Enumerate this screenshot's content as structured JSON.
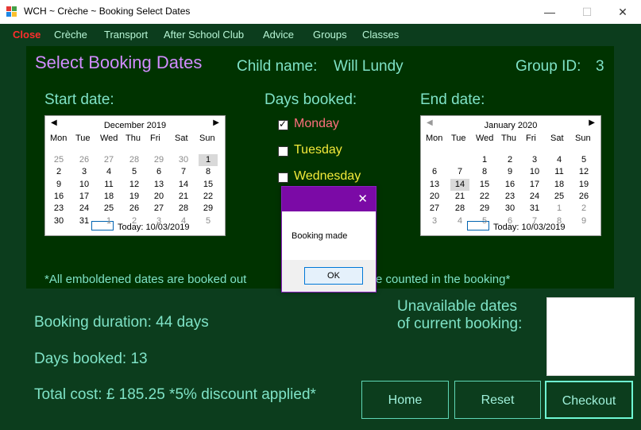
{
  "window": {
    "title": "WCH ~ Crèche ~ Booking Select Dates",
    "minimize": "—",
    "maximize": "☐",
    "close": "✕"
  },
  "menu": {
    "close": "Close",
    "items": [
      "Crèche",
      "Transport",
      "After School Club",
      "Advice",
      "Groups",
      "Classes"
    ]
  },
  "header": {
    "title": "Select Booking Dates",
    "child_label": "Child name:",
    "child_name": "Will Lundy",
    "group_label": "Group ID:",
    "group_id": "3"
  },
  "start": {
    "label": "Start date:",
    "month": "December 2019",
    "dow": [
      "Mon",
      "Tue",
      "Wed",
      "Thu",
      "Fri",
      "Sat",
      "Sun"
    ],
    "weeks": [
      [
        "25",
        "26",
        "27",
        "28",
        "29",
        "30",
        "1"
      ],
      [
        "2",
        "3",
        "4",
        "5",
        "6",
        "7",
        "8"
      ],
      [
        "9",
        "10",
        "11",
        "12",
        "13",
        "14",
        "15"
      ],
      [
        "16",
        "17",
        "18",
        "19",
        "20",
        "21",
        "22"
      ],
      [
        "23",
        "24",
        "25",
        "26",
        "27",
        "28",
        "29"
      ],
      [
        "30",
        "31",
        "1",
        "2",
        "3",
        "4",
        "5"
      ]
    ],
    "today": "Today: 10/03/2019"
  },
  "end": {
    "label": "End date:",
    "month": "January 2020",
    "dow": [
      "Mon",
      "Tue",
      "Wed",
      "Thu",
      "Fri",
      "Sat",
      "Sun"
    ],
    "weeks": [
      [
        "",
        "",
        "1",
        "2",
        "3",
        "4",
        "5"
      ],
      [
        "6",
        "7",
        "8",
        "9",
        "10",
        "11",
        "12"
      ],
      [
        "13",
        "14",
        "15",
        "16",
        "17",
        "18",
        "19"
      ],
      [
        "20",
        "21",
        "22",
        "23",
        "24",
        "25",
        "26"
      ],
      [
        "27",
        "28",
        "29",
        "30",
        "31",
        "1",
        "2"
      ],
      [
        "3",
        "4",
        "5",
        "6",
        "7",
        "8",
        "9"
      ]
    ],
    "today": "Today: 10/03/2019"
  },
  "days": {
    "label": "Days booked:",
    "items": [
      {
        "label": "Monday",
        "checked": true,
        "color": "#ff6f7d"
      },
      {
        "label": "Tuesday",
        "checked": false,
        "color": "#f4ea3a"
      },
      {
        "label": "Wednesday",
        "checked": false,
        "color": "#f4ea3a"
      }
    ]
  },
  "note": "*All emboldened dates are booked out",
  "note_tail": "e counted in the booking*",
  "summary": {
    "duration": "Booking duration:  44 days",
    "days_booked": "Days booked:  13",
    "total": "Total cost:  £ 185.25   *5% discount applied*",
    "unavailable": "Unavailable dates",
    "unavailable2": "of current booking:"
  },
  "buttons": {
    "home": "Home",
    "reset": "Reset",
    "checkout": "Checkout"
  },
  "dialog": {
    "message": "Booking made",
    "ok": "OK",
    "close": "✕"
  }
}
